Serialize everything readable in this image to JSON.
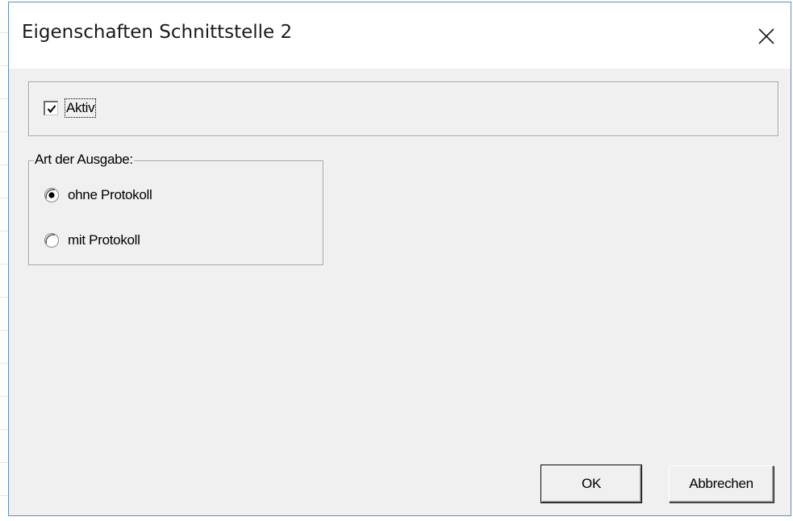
{
  "window": {
    "title": "Eigenschaften Schnittstelle 2",
    "close_icon": "close-icon"
  },
  "aktiv": {
    "label": "Aktiv",
    "checked": true
  },
  "output_group": {
    "legend": "Art der Ausgabe:",
    "options": [
      {
        "label": "ohne Protokoll",
        "selected": true
      },
      {
        "label": "mit Protokoll",
        "selected": false
      }
    ]
  },
  "buttons": {
    "ok_label": "OK",
    "cancel_label": "Abbrechen"
  },
  "colors": {
    "dialog_background": "#f0f0f0",
    "titlebar_background": "#ffffff",
    "window_border": "#5b8ec9"
  }
}
